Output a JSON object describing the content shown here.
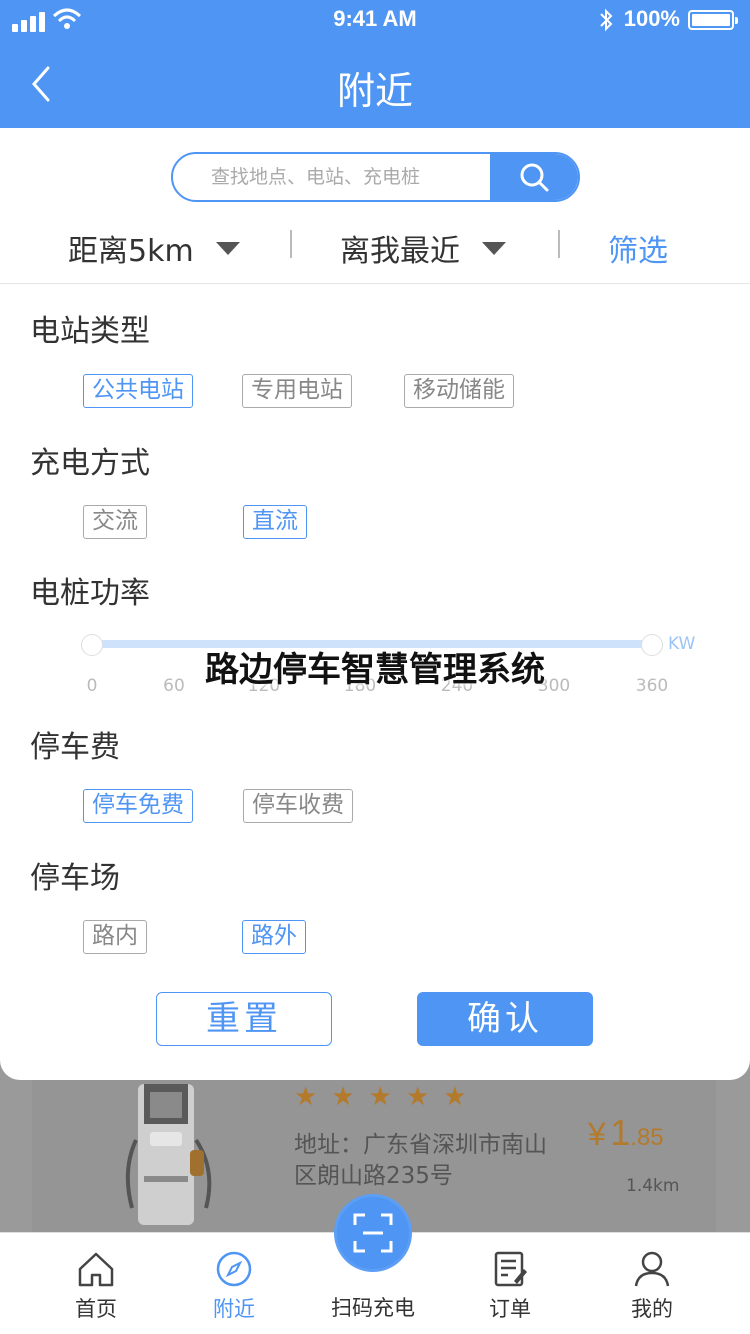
{
  "status_bar": {
    "time": "9:41 AM",
    "battery": "100%"
  },
  "header": {
    "title": "附近"
  },
  "search": {
    "placeholder": "查找地点、电站、充电桩"
  },
  "sort_bar": {
    "distance": "距离5km",
    "order": "离我最近",
    "filter": "筛选"
  },
  "filters": {
    "station_type": {
      "title": "电站类型",
      "options": [
        "公共电站",
        "专用电站",
        "移动储能"
      ],
      "selected": "公共电站"
    },
    "charge_mode": {
      "title": "充电方式",
      "options": [
        "交流",
        "直流"
      ],
      "selected": "直流"
    },
    "power": {
      "title": "电桩功率",
      "unit": "KW",
      "ticks": [
        "0",
        "60",
        "120",
        "180",
        "240",
        "300",
        "360"
      ],
      "range": [
        0,
        360
      ]
    },
    "parking_fee": {
      "title": "停车费",
      "options": [
        "停车免费",
        "停车收费"
      ],
      "selected": "停车免费"
    },
    "parking_lot": {
      "title": "停车场",
      "options": [
        "路内",
        "路外"
      ],
      "selected": "路外"
    }
  },
  "actions": {
    "reset": "重置",
    "confirm": "确认"
  },
  "watermark": "路边停车智慧管理系统",
  "station_card": {
    "rating": 5,
    "address": "地址：广东省深圳市南山区朗山路235号",
    "price_currency": "¥",
    "price_int": "1",
    "price_dec": ".85",
    "distance": "1.4km"
  },
  "tabbar": {
    "home": "首页",
    "nearby": "附近",
    "scan": "扫码充电",
    "orders": "订单",
    "mine": "我的"
  },
  "colors": {
    "primary": "#4f95f4",
    "star": "#b37a2c"
  }
}
